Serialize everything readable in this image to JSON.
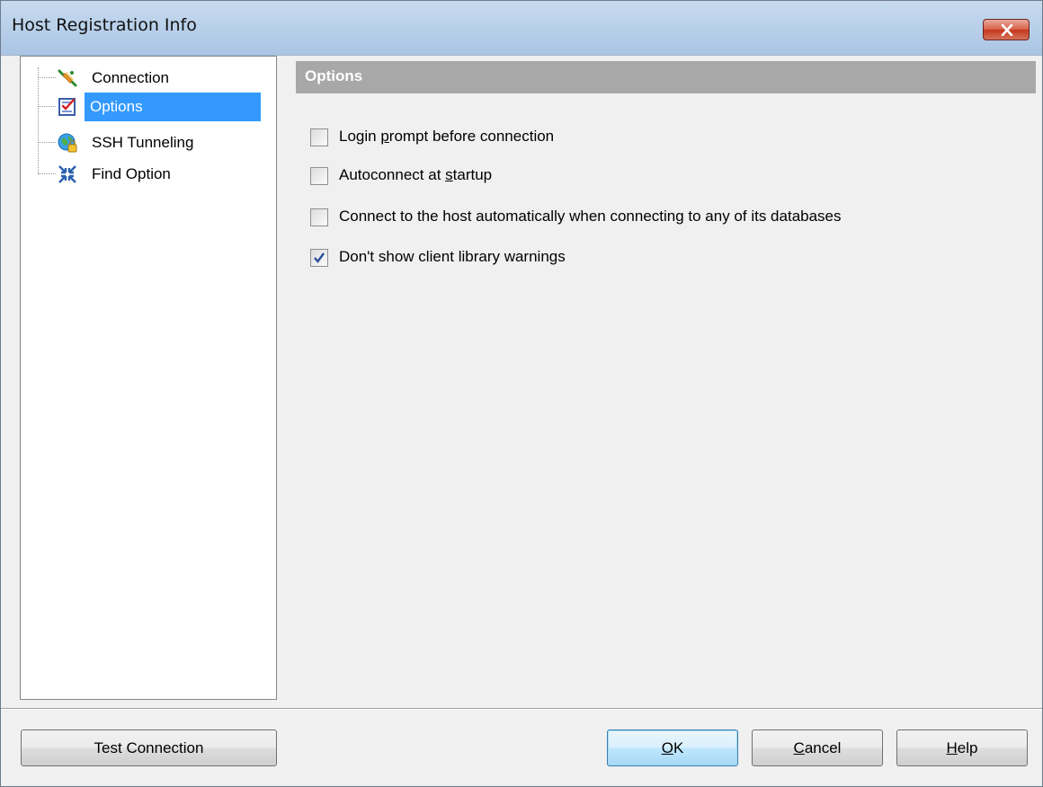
{
  "window": {
    "title": "Host Registration Info"
  },
  "tree": {
    "items": [
      {
        "label": "Connection",
        "icon": "plug-icon",
        "selected": false
      },
      {
        "label": "Options",
        "icon": "checklist-icon",
        "selected": true
      },
      {
        "label": "SSH Tunneling",
        "icon": "globe-lock-icon",
        "selected": false
      },
      {
        "label": "Find Option",
        "icon": "find-arrows-icon",
        "selected": false
      }
    ]
  },
  "panel": {
    "title": "Options",
    "options": [
      {
        "pre": "Login ",
        "accel": "p",
        "post": "rompt before connection",
        "checked": false
      },
      {
        "pre": "Autoconnect at ",
        "accel": "s",
        "post": "tartup",
        "checked": false
      },
      {
        "pre": "Connect to the host automatically when connecting to any of its databases",
        "accel": "",
        "post": "",
        "checked": false
      },
      {
        "pre": "Don't show client library warnings",
        "accel": "",
        "post": "",
        "checked": true
      }
    ]
  },
  "buttons": {
    "test_connection": "Test Connection",
    "ok": {
      "accel": "O",
      "rest": "K"
    },
    "cancel": {
      "accel": "C",
      "rest": "ancel"
    },
    "help": {
      "accel": "H",
      "rest": "elp"
    }
  },
  "colors": {
    "selection": "#3399ff",
    "header_bg": "#a8a8a8",
    "titlebar": "#bad1ea",
    "close": "#c2371c"
  }
}
